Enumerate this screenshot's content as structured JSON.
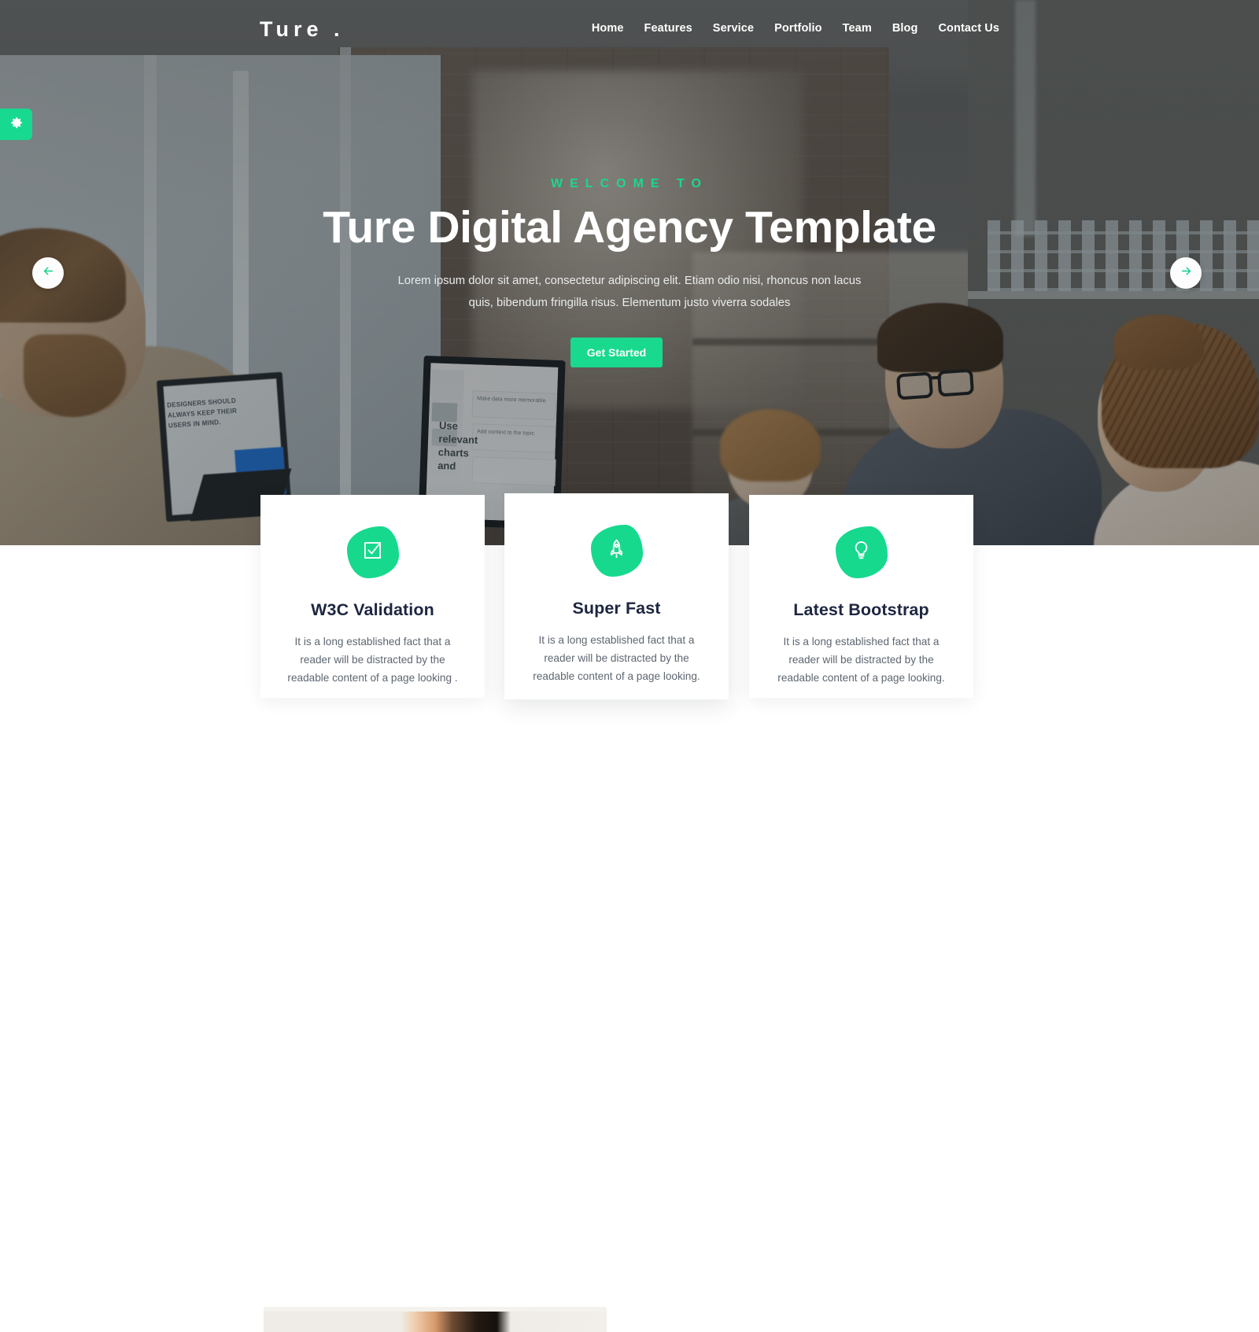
{
  "brand": {
    "logo": "Ture ."
  },
  "nav": {
    "items": [
      {
        "label": "Home"
      },
      {
        "label": "Features"
      },
      {
        "label": "Service"
      },
      {
        "label": "Portfolio"
      },
      {
        "label": "Team"
      },
      {
        "label": "Blog"
      },
      {
        "label": "Contact Us"
      }
    ]
  },
  "settings_tab": {
    "icon": "gear-icon"
  },
  "carousel": {
    "prev_icon": "arrow-left-icon",
    "next_icon": "arrow-right-icon"
  },
  "hero": {
    "eyebrow": "WELCOME TO",
    "title": "Ture Digital Agency Template",
    "subtitle": "Lorem ipsum dolor sit amet, consectetur adipiscing elit. Etiam odio nisi, rhoncus non lacus quis, bibendum fringilla risus. Elementum justo viverra sodales",
    "cta_label": "Get Started"
  },
  "features": {
    "cards": [
      {
        "icon": "check-square-icon",
        "title": "W3C Validation",
        "text": "It is a long established fact that a reader will be distracted by the readable content of a page looking ."
      },
      {
        "icon": "rocket-icon",
        "title": "Super Fast",
        "text": "It is a long established fact that a reader will be distracted by the readable content of a page looking."
      },
      {
        "icon": "lightbulb-icon",
        "title": "Latest Bootstrap",
        "text": "It is a long established fact that a reader will be distracted by the readable content of a page looking."
      }
    ]
  },
  "colors": {
    "accent_green": "#17D98F",
    "heading_dark": "#1D2640",
    "body_text": "#5D6670",
    "white": "#FFFFFF"
  }
}
